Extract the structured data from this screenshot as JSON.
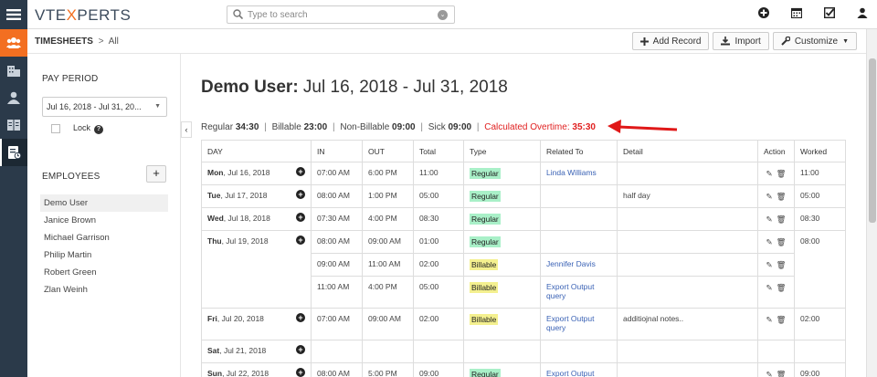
{
  "app": {
    "logo_prefix": "VTE",
    "logo_x": "X",
    "logo_suffix": "PERTS"
  },
  "search": {
    "placeholder": "Type to search"
  },
  "breadcrumb": {
    "module": "TIMESHEETS",
    "separator": ">",
    "current": "All"
  },
  "toolbar": {
    "add_record": "Add Record",
    "import": "Import",
    "customize": "Customize"
  },
  "pay_period": {
    "title": "PAY PERIOD",
    "selected": "Jul 16, 2018 - Jul 31, 20...",
    "lock_label": "Lock"
  },
  "employees": {
    "title": "EMPLOYEES",
    "add_label": "+",
    "items": [
      "Demo User",
      "Janice Brown",
      "Michael Garrison",
      "Philip Martin",
      "Robert Green",
      "Zlan Weinh"
    ]
  },
  "heading": {
    "user": "Demo User:",
    "range": " Jul 16, 2018 - Jul 31, 2018"
  },
  "summary": {
    "regular_label": "Regular",
    "regular_value": "34:30",
    "billable_label": "Billable",
    "billable_value": "23:00",
    "nonbillable_label": "Non-Billable",
    "nonbillable_value": "09:00",
    "sick_label": "Sick",
    "sick_value": "09:00",
    "overtime_label": "Calculated Overtime:",
    "overtime_value": "35:30",
    "pipe": "|"
  },
  "columns": [
    "DAY",
    "IN",
    "OUT",
    "Total",
    "Type",
    "Related To",
    "Detail",
    "Action",
    "Worked"
  ],
  "rows": [
    {
      "dow": "Mon",
      "date": ", Jul 16, 2018",
      "in": "07:00 AM",
      "out": "6:00 PM",
      "total": "11:00",
      "type": "Regular",
      "related": "Linda Williams",
      "detail": "",
      "worked": "11:00"
    },
    {
      "dow": "Tue",
      "date": ", Jul 17, 2018",
      "in": "08:00 AM",
      "out": "1:00 PM",
      "total": "05:00",
      "type": "Regular",
      "related": "",
      "detail": "half day",
      "worked": "05:00"
    },
    {
      "dow": "Wed",
      "date": ", Jul 18, 2018",
      "in": "07:30 AM",
      "out": "4:00 PM",
      "total": "08:30",
      "type": "Regular",
      "related": "",
      "detail": "",
      "worked": "08:30"
    },
    {
      "dow": "Thu",
      "date": ", Jul 19, 2018",
      "in": "08:00 AM",
      "out": "09:00 AM",
      "total": "01:00",
      "type": "Regular",
      "related": "",
      "detail": "",
      "worked": "08:00"
    },
    {
      "in": "09:00 AM",
      "out": "11:00 AM",
      "total": "02:00",
      "type": "Billable",
      "related": "Jennifer Davis",
      "detail": ""
    },
    {
      "in": "11:00 AM",
      "out": "4:00 PM",
      "total": "05:00",
      "type": "Billable",
      "related_line1": "Export Output",
      "related_line2": "query",
      "detail": ""
    },
    {
      "dow": "Fri",
      "date": ", Jul 20, 2018",
      "in": "07:00 AM",
      "out": "09:00 AM",
      "total": "02:00",
      "type": "Billable",
      "related_line1": "Export Output",
      "related_line2": "query",
      "detail": "additiojnal notes..",
      "worked": "02:00"
    },
    {
      "dow": "Sat",
      "date": ", Jul 21, 2018"
    },
    {
      "dow": "Sun",
      "date": ", Jul 22, 2018",
      "in": "08:00 AM",
      "out": "5:00 PM",
      "total": "09:00",
      "type": "Regular",
      "related": "Export Output",
      "worked": "09:00"
    }
  ],
  "colors": {
    "accent": "#f36f21",
    "rail": "#2b3a4a",
    "overtime": "#e02020",
    "regular_tag": "#a9f0c8",
    "billable_tag": "#f4f08f",
    "link": "#3a62b5"
  },
  "icons": [
    "menu-icon",
    "users-icon",
    "building-icon",
    "user-icon",
    "book-icon",
    "timesheet-icon",
    "search-icon",
    "clear-icon",
    "plus-circle-icon",
    "calendar-icon",
    "checkbox-icon",
    "person-icon",
    "pencil-icon",
    "trash-icon"
  ]
}
